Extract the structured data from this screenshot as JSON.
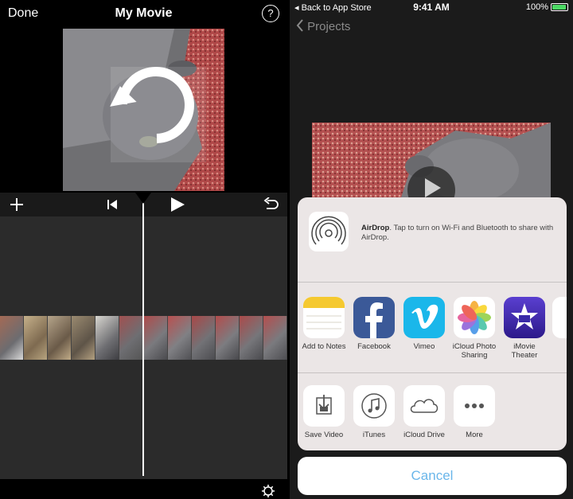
{
  "left": {
    "done_label": "Done",
    "title": "My Movie",
    "help_label": "?"
  },
  "right": {
    "status": {
      "back_label": "Back to App Store",
      "time": "9:41 AM",
      "battery": "100%"
    },
    "projects_label": "Projects",
    "airdrop": {
      "title": "AirDrop",
      "text": ". Tap to turn on Wi-Fi and Bluetooth to share with AirDrop."
    },
    "apps_row1": [
      {
        "label": "Add to Notes",
        "icon": "notes-icon"
      },
      {
        "label": "Facebook",
        "icon": "facebook-icon"
      },
      {
        "label": "Vimeo",
        "icon": "vimeo-icon"
      },
      {
        "label": "iCloud Photo Sharing",
        "icon": "photos-icon"
      },
      {
        "label": "iMovie Theater",
        "icon": "imovie-icon"
      }
    ],
    "apps_row2": [
      {
        "label": "Save Video",
        "icon": "save-video-icon"
      },
      {
        "label": "iTunes",
        "icon": "itunes-icon"
      },
      {
        "label": "iCloud Drive",
        "icon": "icloud-drive-icon"
      },
      {
        "label": "More",
        "icon": "more-icon"
      }
    ],
    "cancel_label": "Cancel"
  },
  "colors": {
    "accent": "#6ab6ea",
    "battery": "#4cd964",
    "sheet": "#ebe6e6"
  }
}
